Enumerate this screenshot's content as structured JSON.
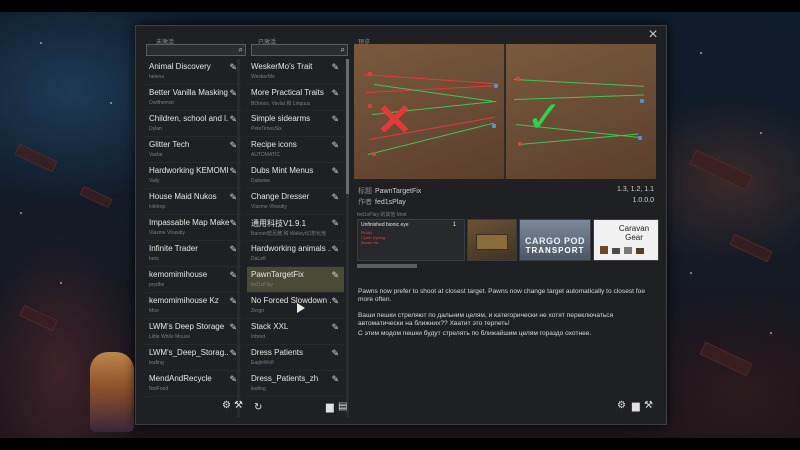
{
  "window": {
    "close_glyph": "×",
    "left_column_label": "未激活",
    "middle_column_label": "已激活",
    "preview_label": "预览",
    "left_search_placeholder": "",
    "middle_search_placeholder": ""
  },
  "inactive_mods": [
    {
      "name": "Animal Discovery",
      "author": "helena"
    },
    {
      "name": "Better Vanilla Masking",
      "author": "Owlthemist"
    },
    {
      "name": "Children, school and l...",
      "author": "Dylan"
    },
    {
      "name": "Glitter Tech",
      "author": "Vavlat"
    },
    {
      "name": "Hardworking KEMOMI...",
      "author": "Vaily"
    },
    {
      "name": "House Maid Nukos",
      "author": "lolidrop"
    },
    {
      "name": "Impassable Map Maker",
      "author": "Vlaxme Vlrasdiy"
    },
    {
      "name": "Infinite Trader",
      "author": "beto"
    },
    {
      "name": "kemomimihouse",
      "author": "prydhe"
    },
    {
      "name": "kemomimihouse Kz",
      "author": "Moo"
    },
    {
      "name": "LWM's Deep Storage",
      "author": "Little White Mouse"
    },
    {
      "name": "LWM's_Deep_Storag...",
      "author": "leafing"
    },
    {
      "name": "MendAndRecycle",
      "author": "NotFood"
    }
  ],
  "active_mods": [
    {
      "name": "WeskerMo's Trait",
      "author": "WeskerMo"
    },
    {
      "name": "More Practical Traits",
      "author": "BOnnxx, Vavlat 和 Linguus"
    },
    {
      "name": "Simple sidearms",
      "author": "PeteTimesSix"
    },
    {
      "name": "Recipe icons",
      "author": "AUTOMATIC"
    },
    {
      "name": "Dubs Mint Menus",
      "author": "Dubwise"
    },
    {
      "name": "Change Dresser",
      "author": "Vlaxme Vlrasdiy"
    },
    {
      "name": "通用科技V1.9.1",
      "author": "Banner欧尼酱 和 Walley/幻想化他"
    },
    {
      "name": "Hardworking animals ...",
      "author": "DaLeft"
    },
    {
      "name": "PawnTargetFix",
      "author": "fed1sPlay"
    },
    {
      "name": "No Forced Slowdown ...",
      "author": "Zergo"
    },
    {
      "name": "Stack XXL",
      "author": "Inbred"
    },
    {
      "name": "Dress Patients",
      "author": "EagleWolf"
    },
    {
      "name": "Dress_Patients_zh",
      "author": "leafing"
    }
  ],
  "selected_mod": {
    "title_key": "标题",
    "title": "PawnTargetFix",
    "author_key": "作者",
    "author": "fed1sPlay",
    "game_versions": "1.3, 1.2, 1.1",
    "mod_version": "1.0.0.0",
    "related_label": "fed1sPlay 的其他 Mod"
  },
  "related_mods": [
    {
      "title": "Unfinished bionic eye",
      "number": "1",
      "lines": [
        "Rt.Md",
        "Cyber Eyeing",
        "Bionic Hd"
      ]
    },
    {
      "title": "",
      "lines": []
    },
    {
      "title": "CARGO POD",
      "subtitle": "TRANSPORT"
    },
    {
      "title": "Caravan Gear"
    }
  ],
  "description": {
    "en": "Pawns now prefer to shoot at closest target. Pawns now change target automatically to closest foe more often.",
    "ru_1": "Ваши пешки стреляют по дальним целям, и категорически не хотят переключаться автоматически на ближних?? Хватит это терпеть!",
    "ru_2": "С этим модом пешки будут стрелять по ближайшим целям гораздо охотнее."
  },
  "colors": {
    "window_bg": "#1e2023",
    "selected_row": "#4b4a36",
    "x_mark": "#e23a3a",
    "check_mark": "#2fd24e"
  },
  "icons": {
    "wrench": "wrench-icon",
    "search": "search-icon",
    "close": "close-icon"
  }
}
